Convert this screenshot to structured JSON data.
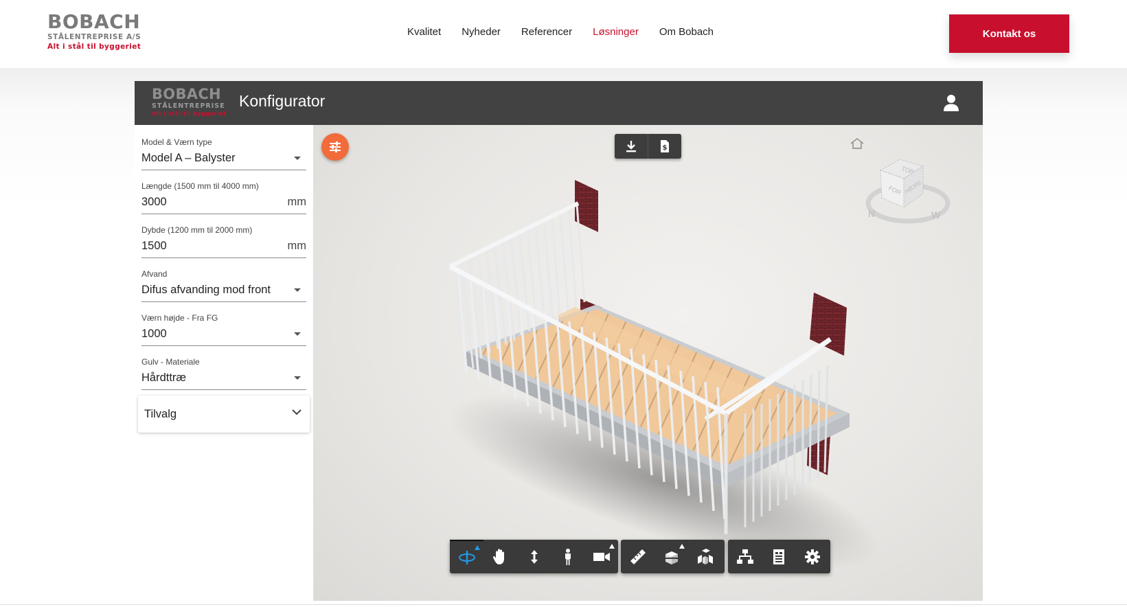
{
  "site": {
    "brand": {
      "name": "BOBACH",
      "sub": "STÅLENTREPRISE A/S",
      "tagline": "Alt i stål til byggeriet"
    },
    "nav": [
      {
        "label": "Kvalitet",
        "active": false
      },
      {
        "label": "Nyheder",
        "active": false
      },
      {
        "label": "Referencer",
        "active": false
      },
      {
        "label": "Løsninger",
        "active": true
      },
      {
        "label": "Om Bobach",
        "active": false
      }
    ],
    "contact_label": "Kontakt os",
    "accent_color": "#c8102e"
  },
  "app": {
    "logo": {
      "name": "BOBACH",
      "sub": "STÅLENTREPRISE",
      "tagline": "Alt i stål til byggeriet"
    },
    "title": "Konfigurator",
    "user_icon": "user-icon"
  },
  "form": {
    "model": {
      "label": "Model & Værn type",
      "value": "Model A – Balyster"
    },
    "length": {
      "label": "Længde (1500 mm til 4000 mm)",
      "value": "3000",
      "unit": "mm"
    },
    "depth": {
      "label": "Dybde (1200 mm til 2000 mm)",
      "value": "1500",
      "unit": "mm"
    },
    "drainage": {
      "label": "Afvand",
      "value": "Difus afvanding mod front"
    },
    "height": {
      "label": "Værn højde - Fra FG",
      "value": "1000"
    },
    "floor": {
      "label": "Gulv - Materiale",
      "value": "Hårdttræ"
    },
    "options_label": "Tilvalg"
  },
  "viewer": {
    "viewcube": {
      "top": "TOP",
      "front": "FOR",
      "right": "HØJRE",
      "north": "N",
      "west": "W"
    },
    "top_tools": [
      "download-icon",
      "price-document-icon"
    ],
    "toolbar_groups": [
      [
        "orbit-icon",
        "pan-icon",
        "dolly-icon",
        "first-person-icon",
        "camera-icon"
      ],
      [
        "measure-icon",
        "section-icon",
        "explode-icon"
      ],
      [
        "model-browser-icon",
        "properties-icon",
        "settings-icon"
      ]
    ]
  }
}
